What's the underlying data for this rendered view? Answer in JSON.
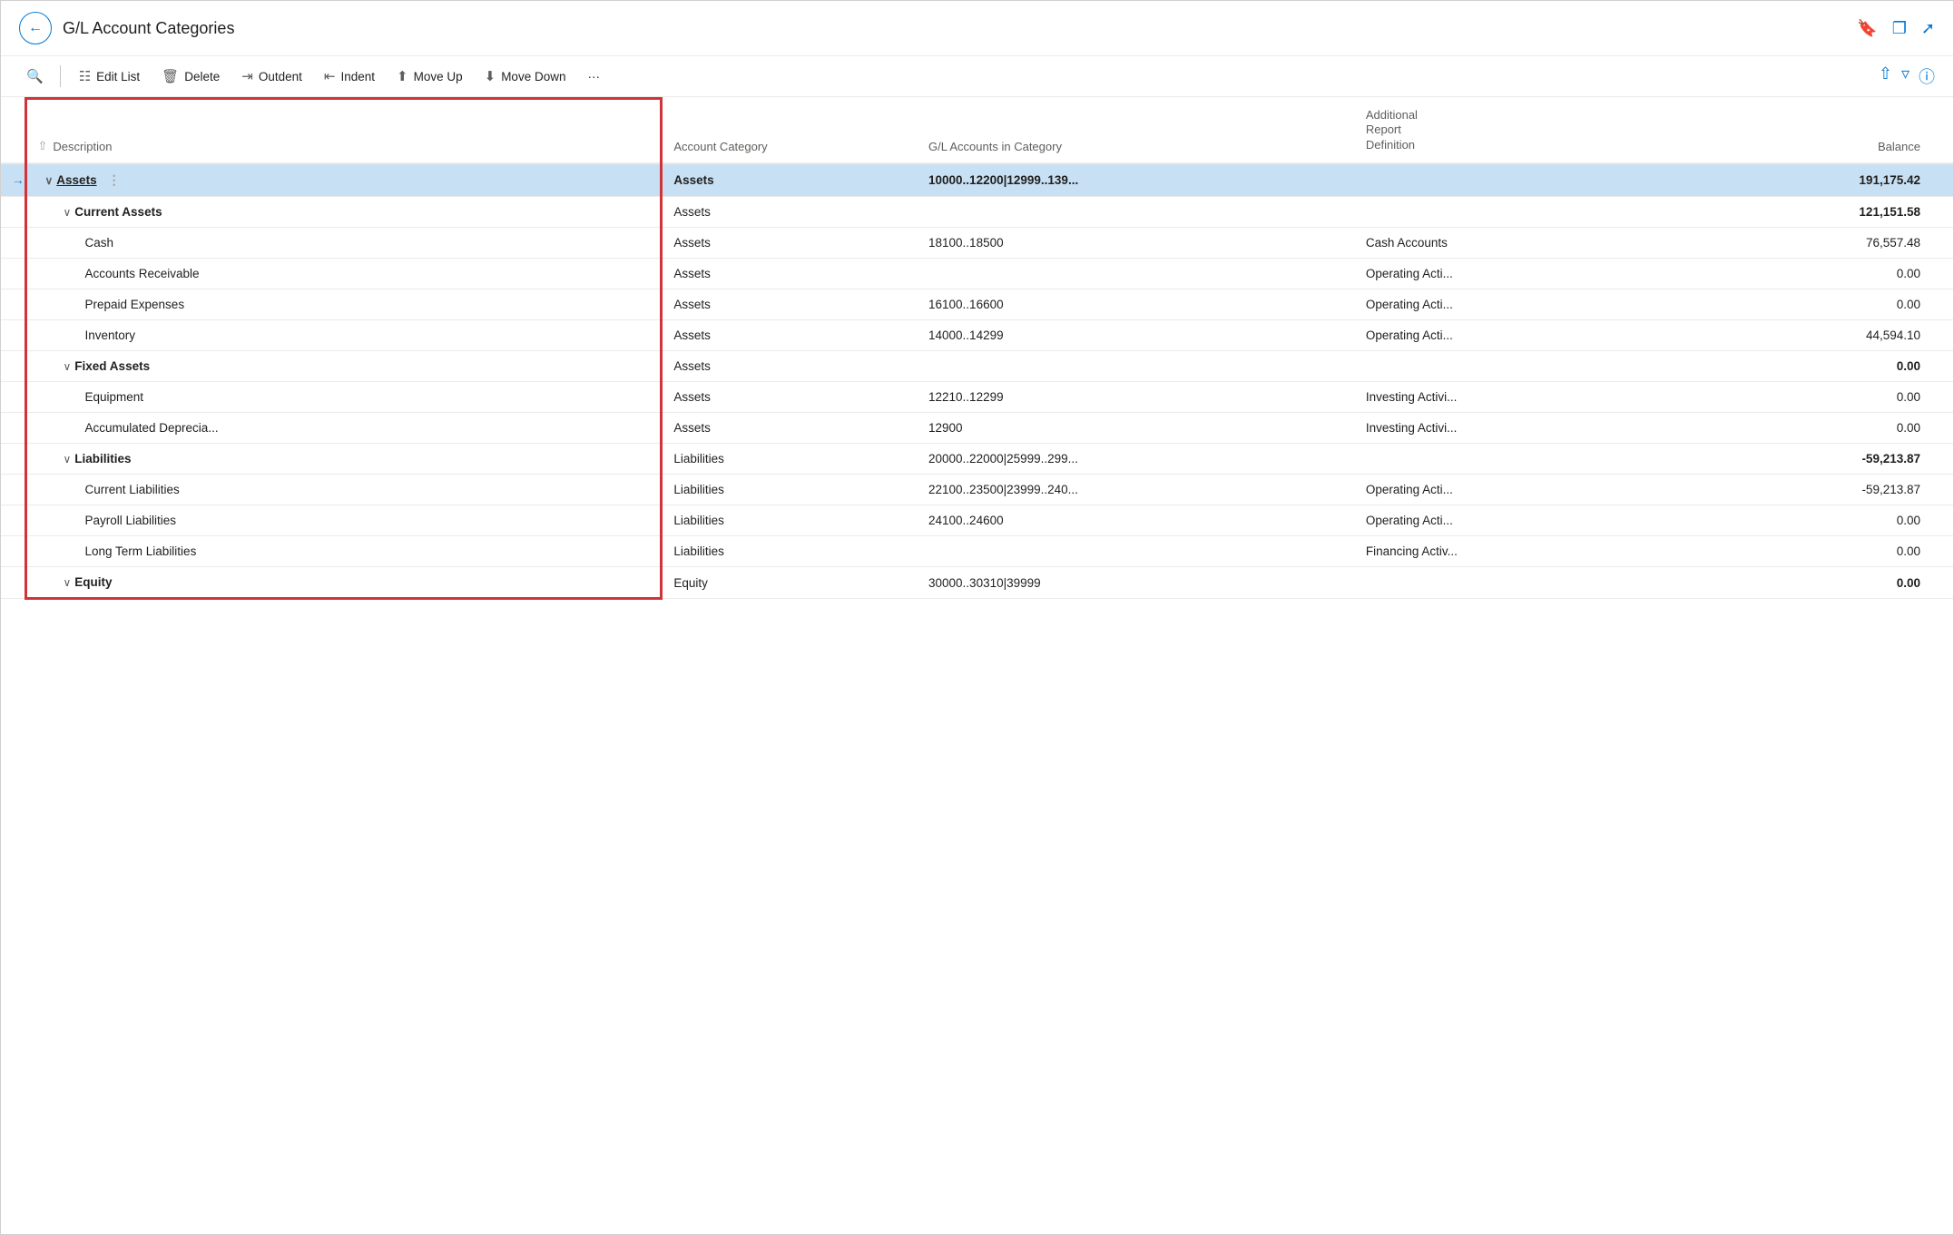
{
  "title": "G/L Account Categories",
  "toolbar": {
    "search_icon": "🔍",
    "edit_list": "Edit List",
    "delete": "Delete",
    "outdent": "Outdent",
    "indent": "Indent",
    "move_up": "Move Up",
    "move_down": "Move Down",
    "more": "···"
  },
  "columns": {
    "description": "Description",
    "account_category": "Account Category",
    "gl_accounts": "G/L Accounts in Category",
    "additional": "Additional Report Definition",
    "balance": "Balance"
  },
  "rows": [
    {
      "id": "assets",
      "indicator": "→",
      "chevron": "∨",
      "indent": 0,
      "bold": true,
      "underline": true,
      "description": "Assets",
      "drag": true,
      "account_category": "Assets",
      "gl_accounts": "10000..12200|12999..139...",
      "additional": "",
      "balance": "191,175.42",
      "balance_bold": true,
      "highlighted": true
    },
    {
      "id": "current-assets",
      "indicator": "",
      "chevron": "∨",
      "indent": 1,
      "bold": true,
      "description": "Current Assets",
      "drag": false,
      "account_category": "Assets",
      "gl_accounts": "",
      "additional": "",
      "balance": "121,151.58",
      "balance_bold": true,
      "highlighted": false
    },
    {
      "id": "cash",
      "indicator": "",
      "chevron": "",
      "indent": 2,
      "bold": false,
      "description": "Cash",
      "drag": false,
      "account_category": "Assets",
      "gl_accounts": "18100..18500",
      "additional": "Cash Accounts",
      "balance": "76,557.48",
      "balance_bold": false,
      "highlighted": false
    },
    {
      "id": "accounts-receivable",
      "indicator": "",
      "chevron": "",
      "indent": 2,
      "bold": false,
      "description": "Accounts Receivable",
      "drag": false,
      "account_category": "Assets",
      "gl_accounts": "",
      "additional": "Operating Acti...",
      "balance": "0.00",
      "balance_bold": false,
      "highlighted": false
    },
    {
      "id": "prepaid-expenses",
      "indicator": "",
      "chevron": "",
      "indent": 2,
      "bold": false,
      "description": "Prepaid Expenses",
      "drag": false,
      "account_category": "Assets",
      "gl_accounts": "16100..16600",
      "additional": "Operating Acti...",
      "balance": "0.00",
      "balance_bold": false,
      "highlighted": false
    },
    {
      "id": "inventory",
      "indicator": "",
      "chevron": "",
      "indent": 2,
      "bold": false,
      "description": "Inventory",
      "drag": false,
      "account_category": "Assets",
      "gl_accounts": "14000..14299",
      "additional": "Operating Acti...",
      "balance": "44,594.10",
      "balance_bold": false,
      "highlighted": false
    },
    {
      "id": "fixed-assets",
      "indicator": "",
      "chevron": "∨",
      "indent": 1,
      "bold": true,
      "description": "Fixed Assets",
      "drag": false,
      "account_category": "Assets",
      "gl_accounts": "",
      "additional": "",
      "balance": "0.00",
      "balance_bold": true,
      "highlighted": false
    },
    {
      "id": "equipment",
      "indicator": "",
      "chevron": "",
      "indent": 2,
      "bold": false,
      "description": "Equipment",
      "drag": false,
      "account_category": "Assets",
      "gl_accounts": "12210..12299",
      "additional": "Investing Activi...",
      "balance": "0.00",
      "balance_bold": false,
      "highlighted": false
    },
    {
      "id": "accumulated-depreciation",
      "indicator": "",
      "chevron": "",
      "indent": 2,
      "bold": false,
      "description": "Accumulated Deprecia...",
      "drag": false,
      "account_category": "Assets",
      "gl_accounts": "12900",
      "additional": "Investing Activi...",
      "balance": "0.00",
      "balance_bold": false,
      "highlighted": false
    },
    {
      "id": "liabilities",
      "indicator": "",
      "chevron": "∨",
      "indent": 1,
      "bold": true,
      "description": "Liabilities",
      "drag": false,
      "account_category": "Liabilities",
      "gl_accounts": "20000..22000|25999..299...",
      "additional": "",
      "balance": "-59,213.87",
      "balance_bold": true,
      "highlighted": false
    },
    {
      "id": "current-liabilities",
      "indicator": "",
      "chevron": "",
      "indent": 2,
      "bold": false,
      "description": "Current Liabilities",
      "drag": false,
      "account_category": "Liabilities",
      "gl_accounts": "22100..23500|23999..240...",
      "additional": "Operating Acti...",
      "balance": "-59,213.87",
      "balance_bold": false,
      "highlighted": false
    },
    {
      "id": "payroll-liabilities",
      "indicator": "",
      "chevron": "",
      "indent": 2,
      "bold": false,
      "description": "Payroll Liabilities",
      "drag": false,
      "account_category": "Liabilities",
      "gl_accounts": "24100..24600",
      "additional": "Operating Acti...",
      "balance": "0.00",
      "balance_bold": false,
      "highlighted": false
    },
    {
      "id": "long-term-liabilities",
      "indicator": "",
      "chevron": "",
      "indent": 2,
      "bold": false,
      "description": "Long Term Liabilities",
      "drag": false,
      "account_category": "Liabilities",
      "gl_accounts": "",
      "additional": "Financing Activ...",
      "balance": "0.00",
      "balance_bold": false,
      "highlighted": false
    },
    {
      "id": "equity",
      "indicator": "",
      "chevron": "∨",
      "indent": 1,
      "bold": true,
      "description": "Equity",
      "drag": false,
      "account_category": "Equity",
      "gl_accounts": "30000..30310|39999",
      "additional": "",
      "balance": "0.00",
      "balance_bold": true,
      "highlighted": false
    }
  ]
}
